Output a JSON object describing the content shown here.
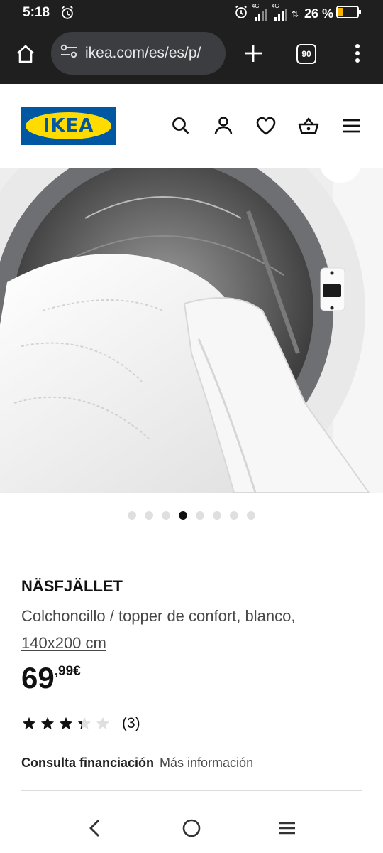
{
  "status_bar": {
    "time": "5:18",
    "network_1": "4G",
    "network_2": "4G",
    "battery": "26 %",
    "battery_level": 0.26,
    "battery_color": "#f4b400"
  },
  "browser": {
    "url": "ikea.com/es/es/p/",
    "tab_count": "90"
  },
  "header": {
    "logo_text": "IKEA",
    "brand_blue": "#0058a3",
    "brand_yellow": "#ffdb00",
    "icons": [
      "search-icon",
      "account-icon",
      "favorites-icon",
      "basket-icon",
      "menu-icon"
    ]
  },
  "gallery": {
    "image_count": 8,
    "active_index": 4
  },
  "product": {
    "name": "NÄSFJÄLLET",
    "description": "Colchoncillo / topper de confort, blanco,",
    "size": "140x200 cm",
    "price_integer": "69",
    "price_decimal": ",99€",
    "rating_value": 3.3,
    "rating_max": 5,
    "review_count": "(3)",
    "financing_label": "Consulta financiación",
    "financing_link": "Más información"
  }
}
